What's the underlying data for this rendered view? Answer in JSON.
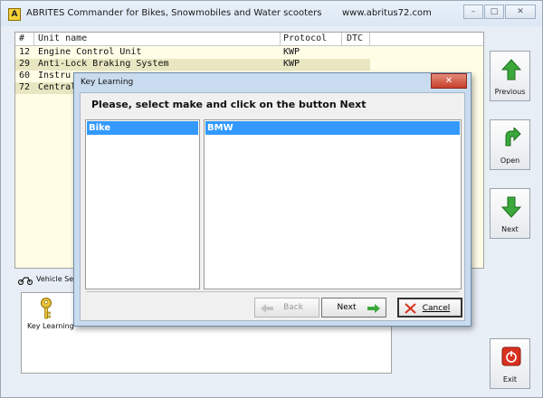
{
  "window": {
    "title": "ABRITES Commander for Bikes, Snowmobiles and Water scooters",
    "url": "www.abritus72.com",
    "app_icon_letter": "A"
  },
  "table": {
    "columns": [
      "#",
      "Unit name",
      "Protocol",
      "DTC"
    ],
    "rows": [
      {
        "num": "12",
        "name": "Engine Control Unit",
        "protocol": "KWP"
      },
      {
        "num": "29",
        "name": "Anti-Lock Braking System",
        "protocol": "KWP"
      },
      {
        "num": "60",
        "name": "Instru",
        "protocol": ""
      },
      {
        "num": "72",
        "name": "Central",
        "protocol": ""
      }
    ]
  },
  "side_buttons": {
    "previous": "Previous",
    "open": "Open",
    "next": "Next",
    "exit": "Exit"
  },
  "bottom": {
    "tab_label": "Vehicle Select",
    "key_learning_label": "Key Learning"
  },
  "dialog": {
    "title": "Key Learning",
    "close_glyph": "✕",
    "prompt": "Please, select make and click on the button Next",
    "left_list": [
      "Bike"
    ],
    "right_list": [
      "BMW"
    ],
    "buttons": {
      "back": "Back",
      "next": "Next",
      "cancel": "Cancel"
    }
  },
  "colors": {
    "accent": "#3399ff",
    "table_bg": "#fffde6",
    "dialog_frame": "#c9dcef",
    "arrow_green": "#3aa83a",
    "exit_red": "#d9301f"
  }
}
